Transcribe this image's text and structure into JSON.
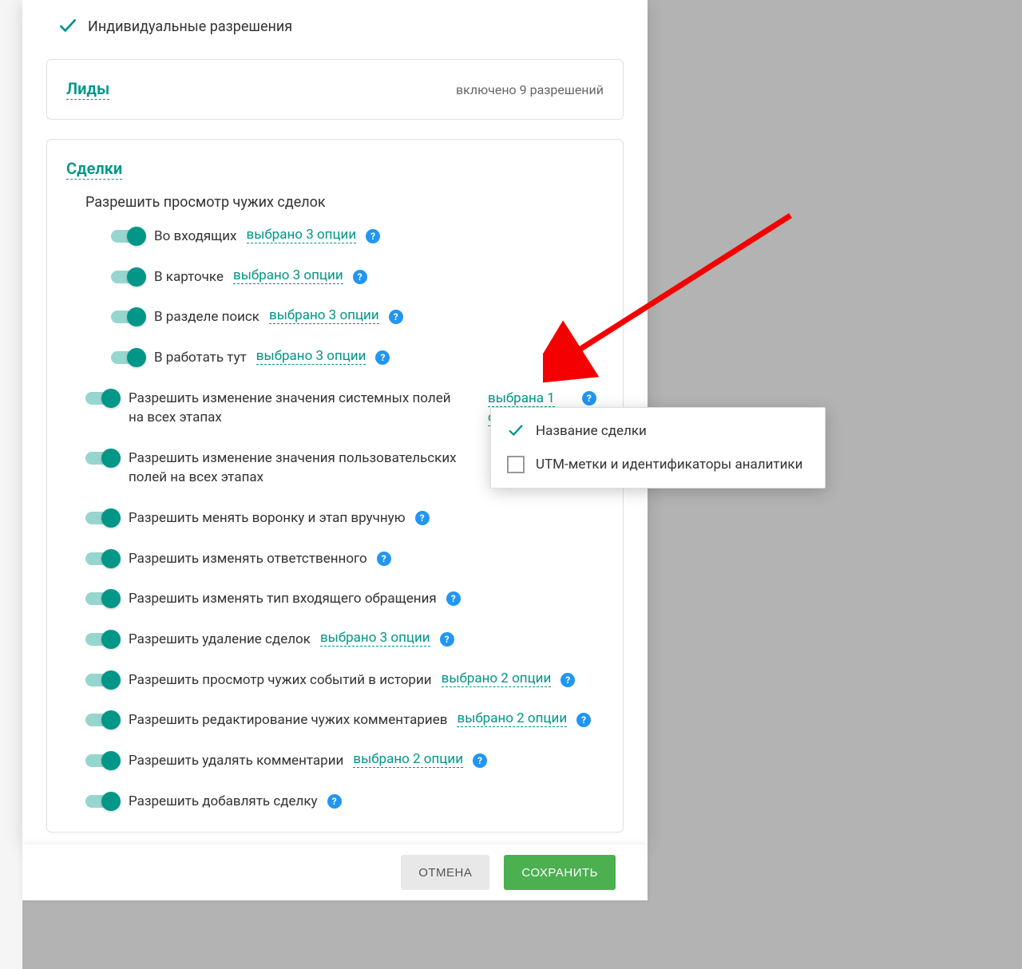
{
  "header": {
    "title": "Индивидуальные разрешения"
  },
  "leads_card": {
    "title": "Лиды",
    "count_text": "включено 9 разрешений"
  },
  "deals": {
    "title": "Сделки",
    "view_section": "Разрешить просмотр чужих сделок",
    "view_rows": [
      {
        "label": "Во входящих",
        "options": "выбрано 3 опции",
        "help": true
      },
      {
        "label": "В карточке",
        "options": "выбрано 3 опции",
        "help": true
      },
      {
        "label": "В разделе поиск",
        "options": "выбрано 3 опции",
        "help": true
      },
      {
        "label": "В работать тут",
        "options": "выбрано 3 опции",
        "help": true
      }
    ],
    "rows": [
      {
        "label": "Разрешить изменение значения системных полей на всех этапах",
        "options_line1": "выбрана 1",
        "options_line2": "опция",
        "help": true,
        "special": true
      },
      {
        "label": "Разрешить изменение значения пользовательских полей на всех этапах"
      },
      {
        "label": "Разрешить менять воронку и этап вручную",
        "help": true
      },
      {
        "label": "Разрешить изменять ответственного",
        "help": true
      },
      {
        "label": "Разрешить изменять тип входящего обращения",
        "help": true
      },
      {
        "label": "Разрешить удаление сделок",
        "options": "выбрано 3 опции",
        "help": true
      },
      {
        "label": "Разрешить просмотр чужих событий в истории",
        "options": "выбрано 2 опции",
        "help": true
      },
      {
        "label": "Разрешить редактирование чужих комментариев",
        "options": "выбрано 2 опции",
        "help": true
      },
      {
        "label": "Разрешить удалять комментарии",
        "options": "выбрано 2 опции",
        "help": true
      },
      {
        "label": "Разрешить добавлять сделку",
        "help": true
      }
    ]
  },
  "popup": {
    "items": [
      {
        "label": "Название сделки",
        "checked": true
      },
      {
        "label": "UTM-метки и идентификаторы аналитики",
        "checked": false
      }
    ]
  },
  "footer": {
    "cancel": "ОТМЕНА",
    "save": "СОХРАНИТЬ"
  },
  "help_glyph": "?"
}
